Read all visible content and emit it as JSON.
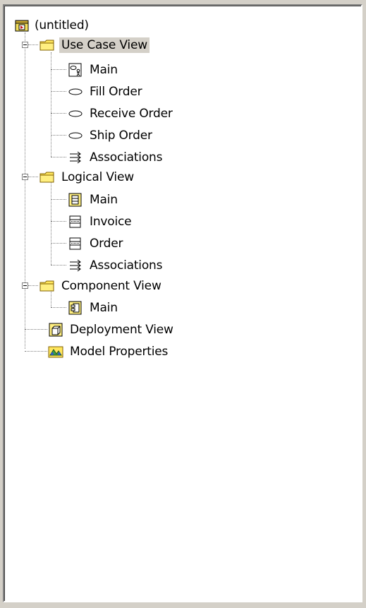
{
  "tree": {
    "root": {
      "label": "(untitled)",
      "icon": "model-icon"
    },
    "use_case_view": {
      "label": "Use Case View",
      "icon": "folder-icon",
      "children": [
        {
          "label": "Main",
          "icon": "use-case-diagram-icon"
        },
        {
          "label": "Fill Order",
          "icon": "use-case-icon"
        },
        {
          "label": "Receive Order",
          "icon": "use-case-icon"
        },
        {
          "label": "Ship Order",
          "icon": "use-case-icon"
        },
        {
          "label": "Associations",
          "icon": "associations-icon"
        }
      ]
    },
    "logical_view": {
      "label": "Logical View",
      "icon": "folder-icon",
      "children": [
        {
          "label": "Main",
          "icon": "class-diagram-icon"
        },
        {
          "label": "Invoice",
          "icon": "class-icon"
        },
        {
          "label": "Order",
          "icon": "class-icon"
        },
        {
          "label": "Associations",
          "icon": "associations-icon"
        }
      ]
    },
    "component_view": {
      "label": "Component View",
      "icon": "folder-icon",
      "children": [
        {
          "label": "Main",
          "icon": "component-diagram-icon"
        }
      ]
    },
    "deployment_view": {
      "label": "Deployment View",
      "icon": "deployment-icon"
    },
    "model_properties": {
      "label": "Model Properties",
      "icon": "model-properties-icon"
    },
    "selected": "Use Case View"
  }
}
